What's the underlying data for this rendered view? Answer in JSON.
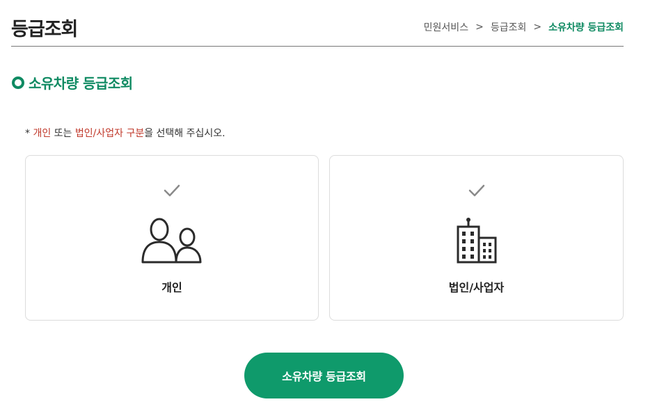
{
  "header": {
    "title": "등급조회",
    "breadcrumb": [
      "민원서비스",
      "등급조회",
      "소유차량 등급조회"
    ],
    "breadcrumb_separator": ">"
  },
  "section": {
    "title": "소유차량 등급조회"
  },
  "instruction": {
    "prefix": "* ",
    "highlight1": "개인",
    "text1": " 또는 ",
    "highlight2": "법인/사업자 구분",
    "text2": "을 선택해 주십시오."
  },
  "options": [
    {
      "label": "개인",
      "icon": "people-icon"
    },
    {
      "label": "법인/사업자",
      "icon": "building-icon"
    }
  ],
  "submit_label": "소유차량 등급조회",
  "colors": {
    "accent": "#0f8a62",
    "button": "#0f9a6b",
    "highlight": "#c0392b"
  }
}
